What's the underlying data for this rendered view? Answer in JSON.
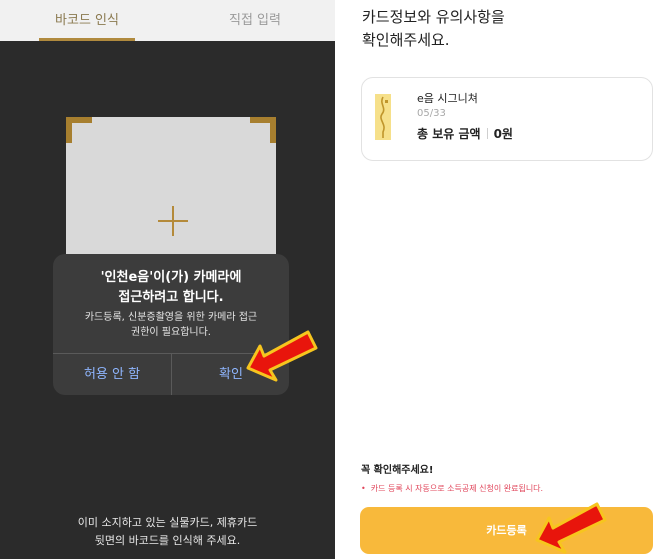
{
  "scan_screen": {
    "tabs": [
      {
        "label": "바코드 인식",
        "active": true
      },
      {
        "label": "직접 입력",
        "active": false
      }
    ],
    "permission_alert": {
      "title": "'인천e음'이(가) 카메라에\n접근하려고 합니다.",
      "message": "카드등록, 신분증촬영을 위한 카메라 접근\n권한이 필요합니다.",
      "deny_label": "허용 안 함",
      "allow_label": "확인"
    },
    "guide_text": "이미 소지하고 있는 실물카드, 제휴카드\n뒷면의 바코드를 인식해 주세요."
  },
  "confirm_screen": {
    "headline": "카드정보와 유의사항을\n확인해주세요.",
    "card": {
      "name": "e음 시그니쳐",
      "date": "05/33",
      "balance_label": "총 보유 금액",
      "balance_value": "0원"
    },
    "notice_title": "꼭 확인해주세요!",
    "notice_items": [
      "카드 등록 시 자동으로 소득공제 신청이 완료됩니다."
    ],
    "register_button": "카드등록"
  },
  "colors": {
    "accent_gold": "#b08a3e",
    "register_button": "#f8b93b",
    "notice_red": "#e0445a",
    "pointer_arrow": "#e8150c"
  },
  "icons": [
    "plus-crosshair-icon",
    "pointer-arrow-icon"
  ]
}
